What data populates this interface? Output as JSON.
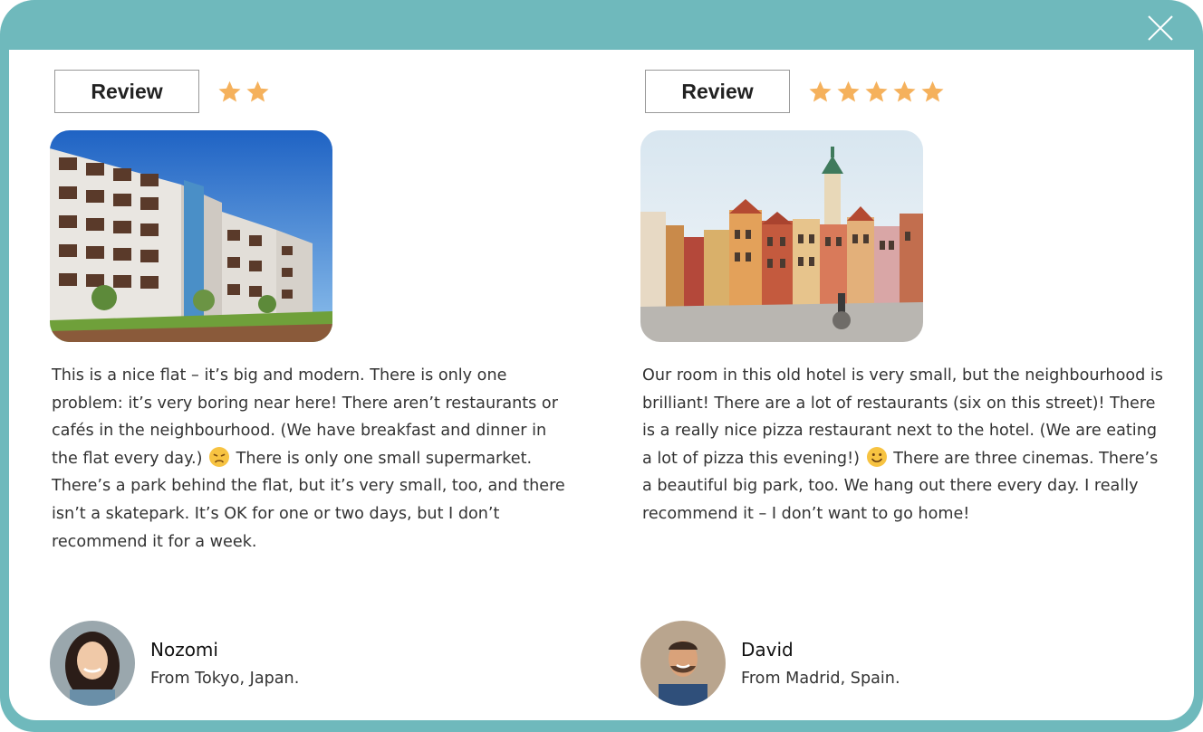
{
  "colors": {
    "frame": "#6fb9bc",
    "star": "#f5b15c"
  },
  "close_icon": "close-icon",
  "reviews": [
    {
      "label": "Review",
      "stars": 2,
      "photo": "apartment-building-image",
      "text_before": "This is a nice flat – it’s big and modern. There is only one problem: it’s very boring near here! There aren’t restaurants or cafés in the neighbourhood. (We have breakfast and dinner in the flat every day.)",
      "emoji": "disappointed-face-icon",
      "text_after": "There is only one small supermarket. There’s a park behind the flat, but it’s very small, too, and there isn’t a skatepark. It’s OK for one or two days, but I don’t recommend it for a week.",
      "author": {
        "name": "Nozomi",
        "origin": "From Tokyo, Japan."
      }
    },
    {
      "label": "Review",
      "stars": 5,
      "photo": "old-town-square-image",
      "text_before": "Our room in this old hotel is very small, but the neighbourhood is brilliant! There are a lot of restaurants (six on this street)! There is a really nice pizza restaurant next to the hotel. (We are eating a lot of pizza this evening!)",
      "emoji": "smiling-face-icon",
      "text_after": "There are three cinemas. There’s a beautiful big park, too. We hang out there every day. I really recommend it – I don’t want to go home!",
      "author": {
        "name": "David",
        "origin": "From Madrid, Spain."
      }
    }
  ]
}
